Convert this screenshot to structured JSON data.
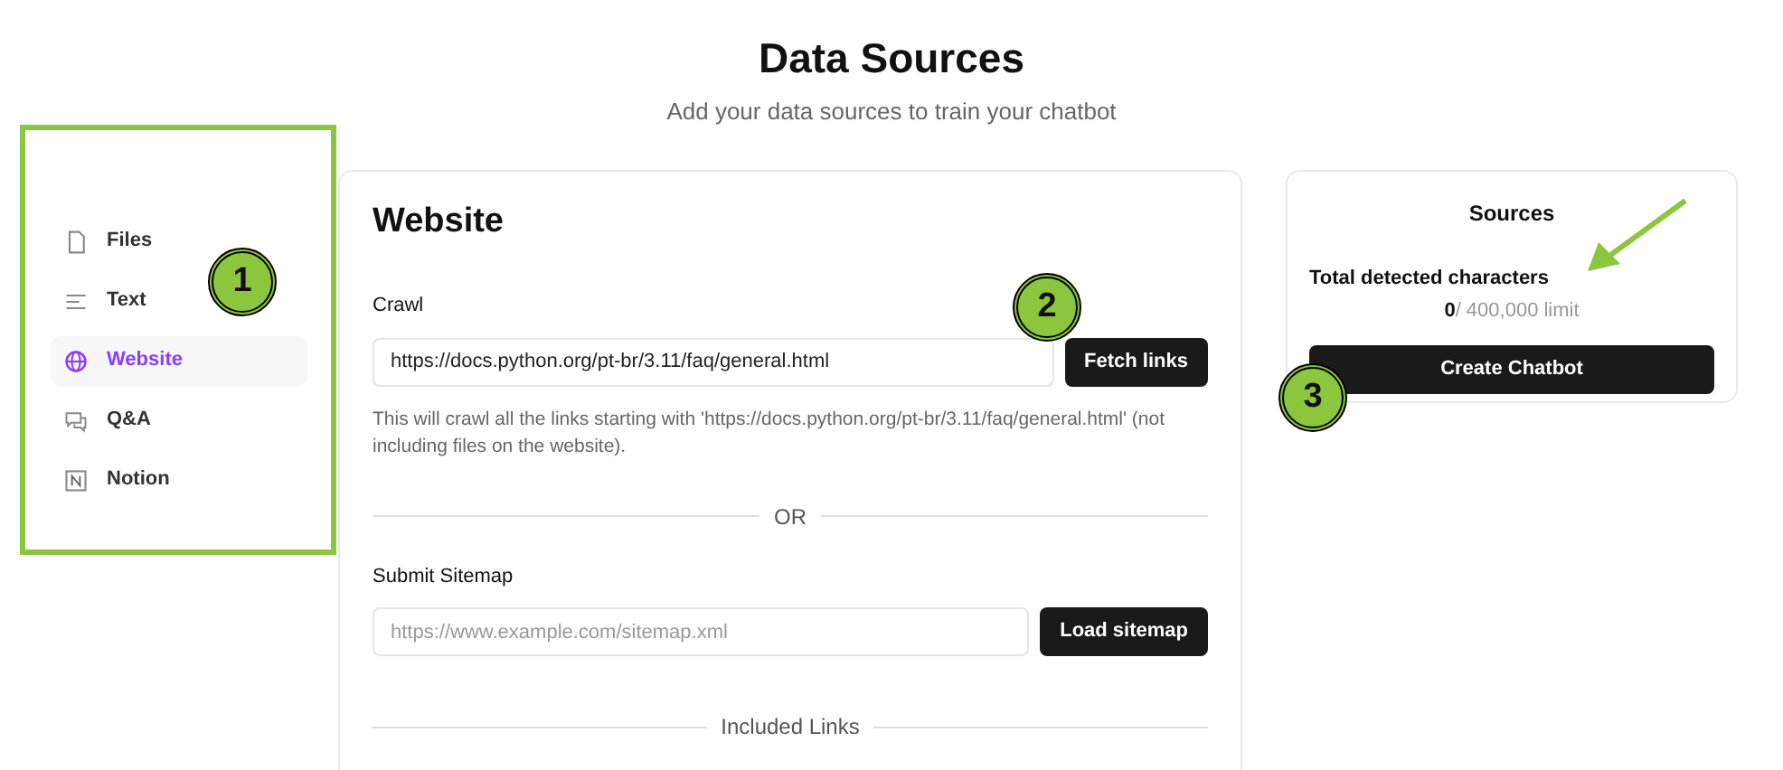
{
  "header": {
    "title": "Data Sources",
    "subtitle": "Add your data sources to train your chatbot"
  },
  "sidebar": {
    "items": [
      {
        "label": "Files",
        "selected": false
      },
      {
        "label": "Text",
        "selected": false
      },
      {
        "label": "Website",
        "selected": true
      },
      {
        "label": "Q&A",
        "selected": false
      },
      {
        "label": "Notion",
        "selected": false
      }
    ]
  },
  "website_panel": {
    "title": "Website",
    "crawl_label": "Crawl",
    "crawl_value": "https://docs.python.org/pt-br/3.11/faq/general.html",
    "fetch_button": "Fetch links",
    "help": "This will crawl all the links starting with 'https://docs.python.org/pt-br/3.11/faq/general.html' (not including files on the website).",
    "divider": "OR",
    "sitemap_label": "Submit Sitemap",
    "sitemap_placeholder": "https://www.example.com/sitemap.xml",
    "sitemap_button": "Load sitemap",
    "included_links": "Included Links"
  },
  "sources_panel": {
    "title": "Sources",
    "total_label": "Total detected characters",
    "count": "**0**/ 400,000 limit",
    "create_button": "Create Chatbot"
  },
  "annotations": [
    {
      "label": "1"
    },
    {
      "label": "2"
    },
    {
      "label": "3"
    }
  ]
}
